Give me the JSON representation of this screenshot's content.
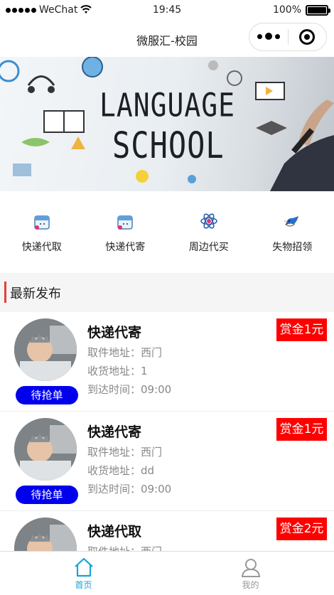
{
  "status_bar": {
    "carrier": "WeChat",
    "time": "19:45",
    "battery": "100%"
  },
  "navbar": {
    "title": "微服汇-校园"
  },
  "banner": {
    "line1": "LANGUAGE",
    "line2": "SCHOOL"
  },
  "categories": [
    {
      "label": "快递代取",
      "icon": "parcel-icon"
    },
    {
      "label": "快递代寄",
      "icon": "parcel-icon"
    },
    {
      "label": "周边代买",
      "icon": "atom-icon"
    },
    {
      "label": "失物招领",
      "icon": "bird-icon"
    }
  ],
  "section": {
    "title": "最新发布"
  },
  "orders": [
    {
      "title": "快递代寄",
      "reward": "赏金1元",
      "pickup": "取件地址：西门",
      "delivery": "收货地址：1",
      "arrive": "到达时间：09:00",
      "status": "待抢单"
    },
    {
      "title": "快递代寄",
      "reward": "赏金1元",
      "pickup": "取件地址：西门",
      "delivery": "收货地址：dd",
      "arrive": "到达时间：09:00",
      "status": "待抢单"
    },
    {
      "title": "快递代取",
      "reward": "赏金2元",
      "pickup": "取件地址：西门",
      "delivery": "",
      "arrive": "",
      "status": ""
    }
  ],
  "tabbar": [
    {
      "label": "首页",
      "icon": "home-icon",
      "active": true
    },
    {
      "label": "我的",
      "icon": "user-icon",
      "active": false
    }
  ],
  "colors": {
    "accent": "#1aa3d6",
    "status_button": "#0000ee",
    "reward": "#ff0000",
    "section_bar": "#e0413a"
  }
}
